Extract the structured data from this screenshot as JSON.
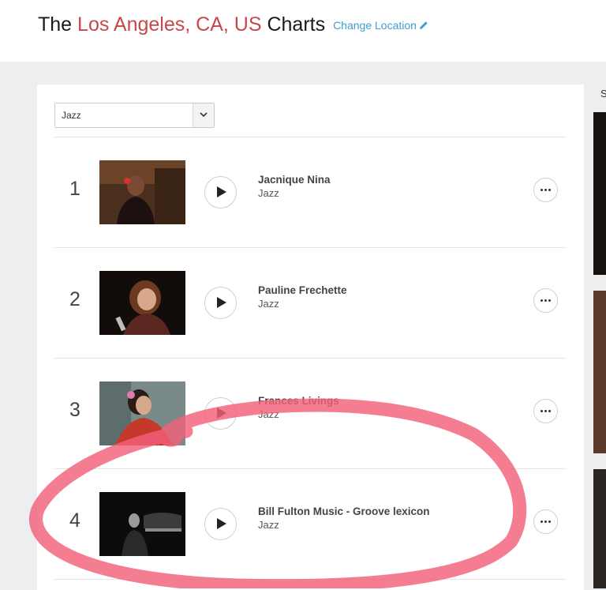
{
  "header": {
    "title_prefix": "The",
    "title_location": "Los Angeles, CA, US",
    "title_suffix": "Charts",
    "change_location": "Change Location"
  },
  "filter": {
    "selected": "Jazz"
  },
  "tracks": [
    {
      "rank": "1",
      "title": "Jacnique Nina",
      "genre": "Jazz"
    },
    {
      "rank": "2",
      "title": "Pauline Frechette",
      "genre": "Jazz"
    },
    {
      "rank": "3",
      "title": "Frances Livings",
      "genre": "Jazz"
    },
    {
      "rank": "4",
      "title": "Bill Fulton Music - Groove lexicon",
      "genre": "Jazz"
    }
  ],
  "sidebar": {
    "heading_fragment": "S"
  },
  "colors": {
    "location_red": "#c8474b",
    "link_blue": "#3d9fd3",
    "annotation_pink": "#f2607a"
  },
  "icons": [
    "pencil-icon",
    "chevron-down-icon",
    "play-icon",
    "more-icon"
  ]
}
